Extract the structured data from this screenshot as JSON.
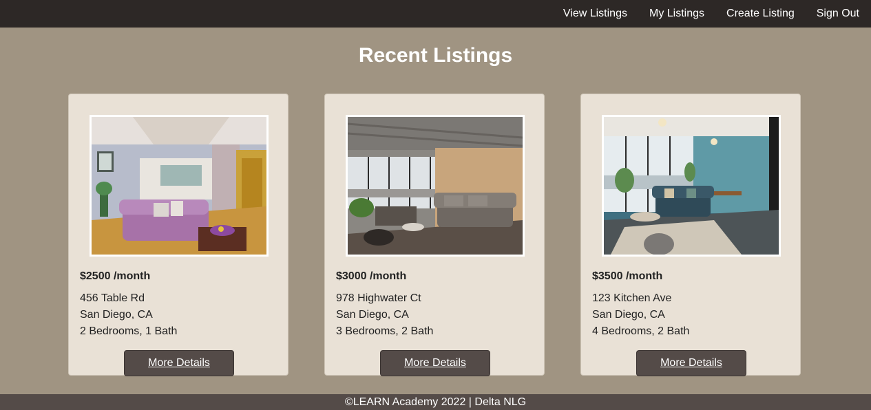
{
  "nav": {
    "links": [
      "View Listings",
      "My Listings",
      "Create Listing",
      "Sign Out"
    ]
  },
  "page": {
    "title": "Recent Listings"
  },
  "listings": [
    {
      "price": "$2500 /month",
      "street": "456 Table Rd",
      "city": "San Diego, CA",
      "rooms": "2 Bedrooms, 1 Bath",
      "button_label": "More Details"
    },
    {
      "price": "$3000 /month",
      "street": "978 Highwater Ct",
      "city": "San Diego, CA",
      "rooms": "3 Bedrooms, 2 Bath",
      "button_label": "More Details"
    },
    {
      "price": "$3500 /month",
      "street": "123 Kitchen Ave",
      "city": "San Diego, CA",
      "rooms": "4 Bedrooms, 2 Bath",
      "button_label": "More Details"
    }
  ],
  "footer": {
    "text": "©LEARN Academy 2022 | Delta NLG"
  },
  "colors": {
    "navbar": "#2d2826",
    "page_background": "#a09482",
    "card_background": "#e9e1d6",
    "button": "#544b48",
    "footer": "#544b48"
  }
}
